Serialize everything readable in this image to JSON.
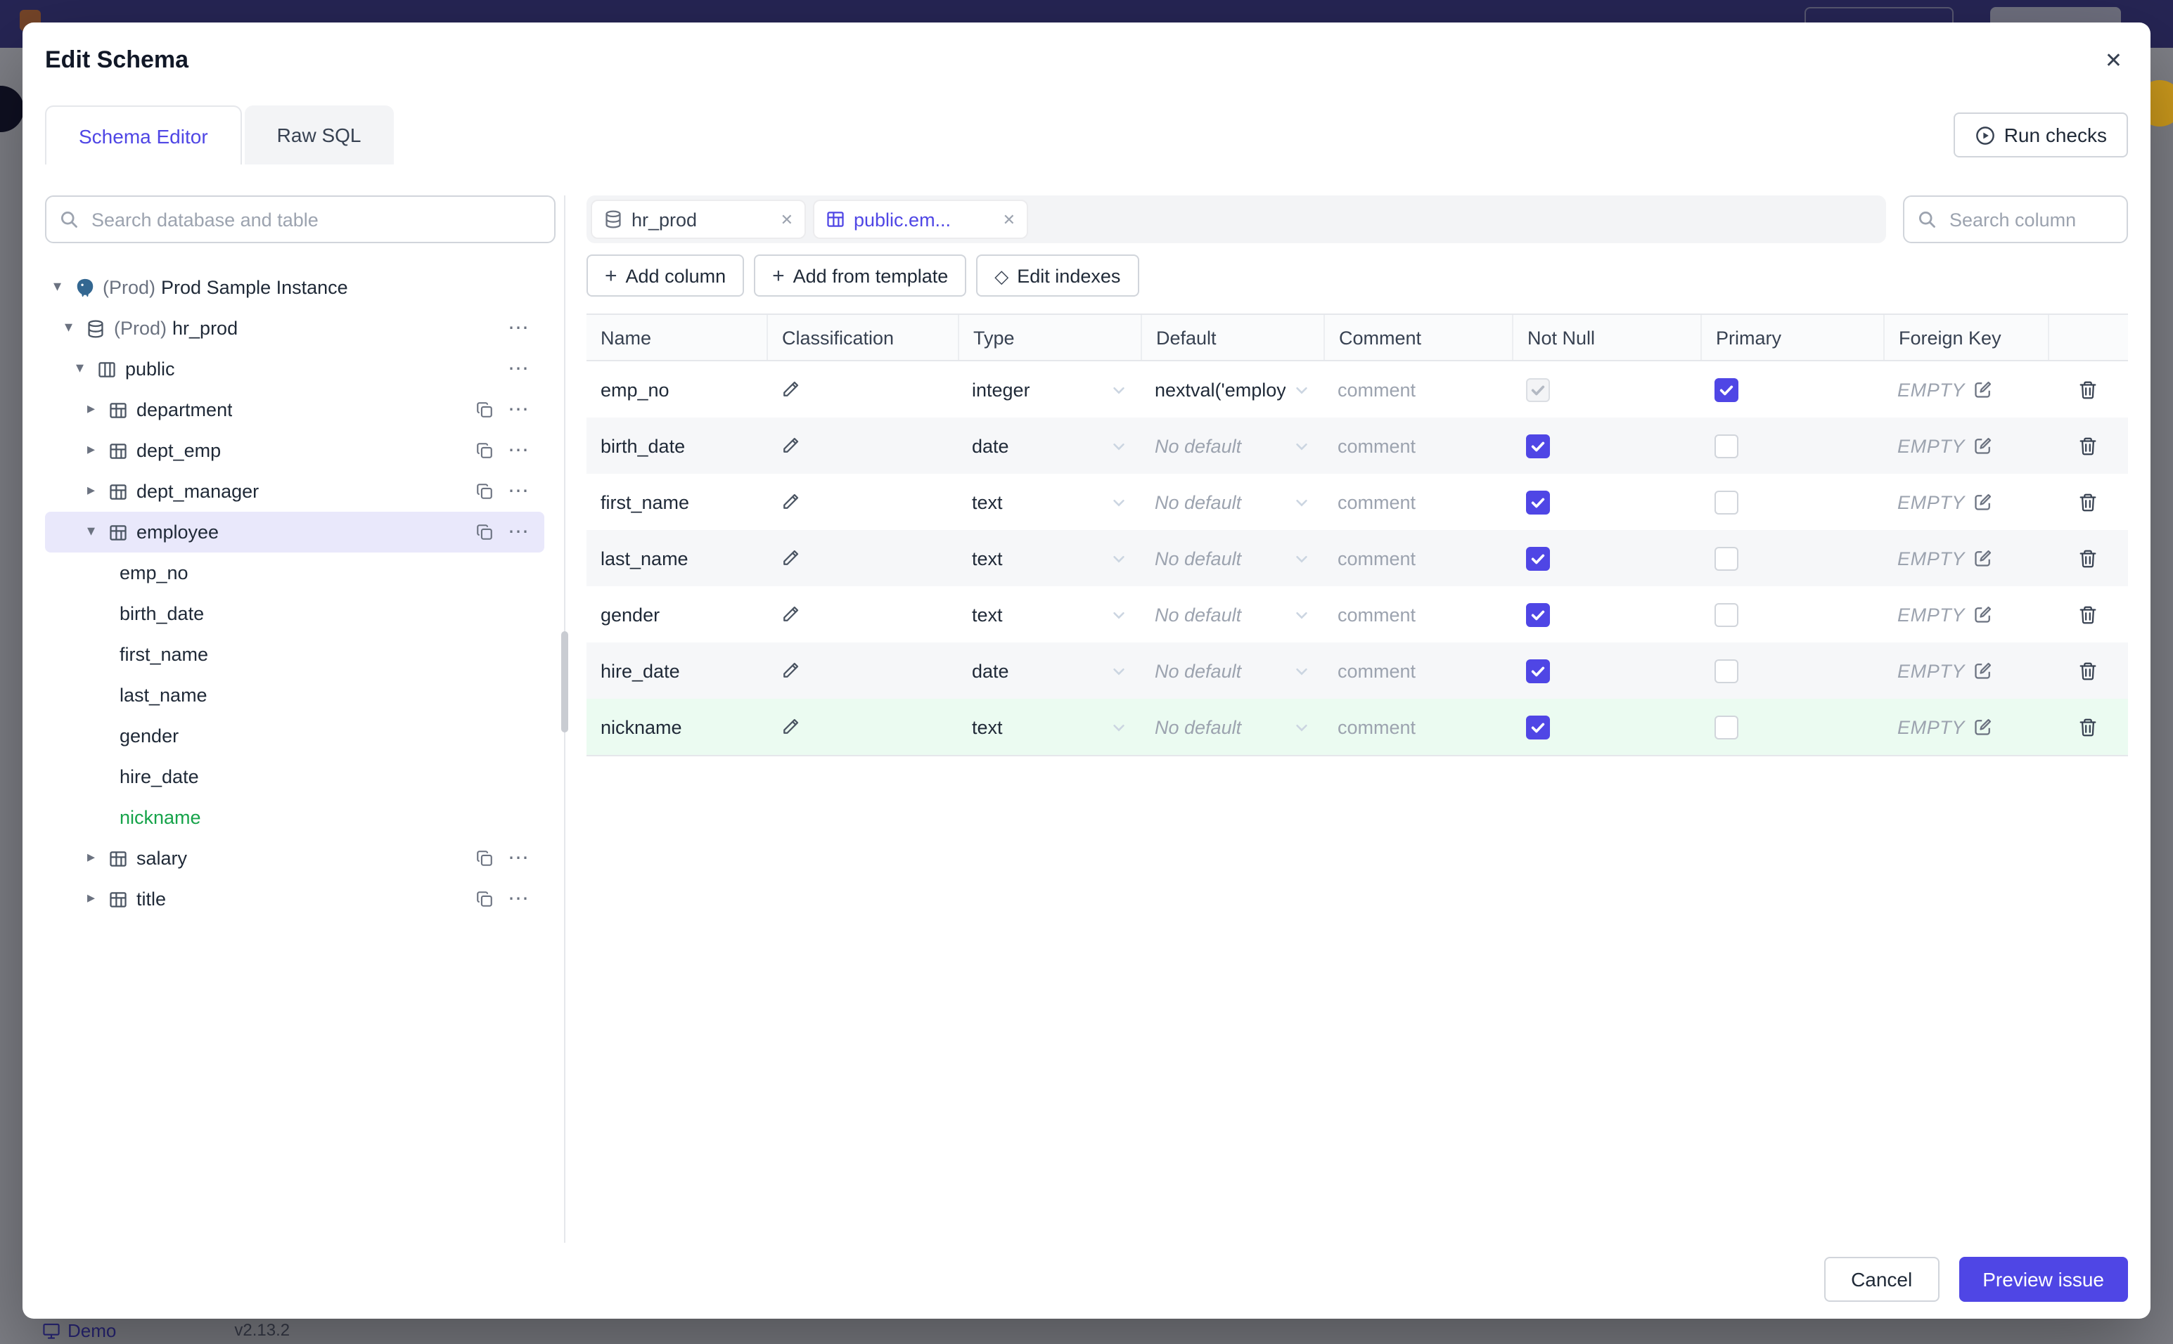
{
  "background": {
    "footer": {
      "demo": "Demo",
      "version": "v2.13.2"
    }
  },
  "colors": {
    "accent": "#4f46e5",
    "new_item_green": "#16a34a",
    "selected_tree_bg": "#e9e8fb",
    "new_row_bg": "#ebfbf1",
    "topbar": "#454295"
  },
  "icons_used": [
    "search-icon",
    "database-icon",
    "table-icon",
    "schema-icon",
    "instance-icon",
    "copy-icon",
    "more-icon",
    "pencil-icon",
    "edit-icon",
    "trash-icon",
    "play-circle-icon",
    "chevron-down-icon",
    "chevron-right-icon",
    "close-icon",
    "monitor-icon",
    "plus-icon",
    "diamond-icon",
    "checkbox"
  ],
  "modal": {
    "title": "Edit Schema",
    "tabs": [
      {
        "label": "Schema Editor",
        "active": true
      },
      {
        "label": "Raw SQL",
        "active": false
      }
    ],
    "run_checks": "Run checks",
    "sidebar": {
      "search_placeholder": "Search database and table",
      "tree": [
        {
          "level": 0,
          "kind": "instance",
          "expander": "open",
          "icon": "instance",
          "prefix": "(Prod)",
          "label": "Prod Sample Instance"
        },
        {
          "level": 1,
          "kind": "database",
          "expander": "open",
          "icon": "database",
          "prefix": "(Prod)",
          "label": "hr_prod",
          "actions": [
            "more"
          ]
        },
        {
          "level": 2,
          "kind": "schema",
          "expander": "open",
          "icon": "schema",
          "label": "public",
          "actions": [
            "more"
          ]
        },
        {
          "level": 3,
          "kind": "table",
          "expander": "closed",
          "icon": "table",
          "label": "department",
          "actions": [
            "copy",
            "more"
          ]
        },
        {
          "level": 3,
          "kind": "table",
          "expander": "closed",
          "icon": "table",
          "label": "dept_emp",
          "actions": [
            "copy",
            "more"
          ]
        },
        {
          "level": 3,
          "kind": "table",
          "expander": "closed",
          "icon": "table",
          "label": "dept_manager",
          "actions": [
            "copy",
            "more"
          ]
        },
        {
          "level": 3,
          "kind": "table",
          "expander": "open",
          "icon": "table",
          "label": "employee",
          "selected": true,
          "actions": [
            "copy",
            "more"
          ]
        },
        {
          "level": 4,
          "kind": "column",
          "label": "emp_no"
        },
        {
          "level": 4,
          "kind": "column",
          "label": "birth_date"
        },
        {
          "level": 4,
          "kind": "column",
          "label": "first_name"
        },
        {
          "level": 4,
          "kind": "column",
          "label": "last_name"
        },
        {
          "level": 4,
          "kind": "column",
          "label": "gender"
        },
        {
          "level": 4,
          "kind": "column",
          "label": "hire_date"
        },
        {
          "level": 4,
          "kind": "column",
          "label": "nickname",
          "green": true
        },
        {
          "level": 3,
          "kind": "table",
          "expander": "closed",
          "icon": "table",
          "label": "salary",
          "actions": [
            "copy",
            "more"
          ]
        },
        {
          "level": 3,
          "kind": "table",
          "expander": "closed",
          "icon": "table",
          "label": "title",
          "actions": [
            "copy",
            "more"
          ]
        }
      ]
    },
    "main": {
      "chips": [
        {
          "label": "hr_prod",
          "icon": "database",
          "active": false
        },
        {
          "label": "public.em...",
          "icon": "table",
          "active": true
        }
      ],
      "column_search_placeholder": "Search column",
      "actions": {
        "add_column": "Add column",
        "add_from_template": "Add from template",
        "edit_indexes": "Edit indexes"
      },
      "table": {
        "headers": [
          "Name",
          "Classification",
          "Type",
          "Default",
          "Comment",
          "Not Null",
          "Primary",
          "Foreign Key",
          ""
        ],
        "comment_placeholder": "comment",
        "fk_empty": "EMPTY",
        "rows": [
          {
            "name": "emp_no",
            "type": "integer",
            "default": "nextval('employ",
            "default_placeholder": false,
            "not_null": "checked-disabled",
            "primary": "checked"
          },
          {
            "name": "birth_date",
            "type": "date",
            "default": "No default",
            "default_placeholder": true,
            "not_null": "checked",
            "primary": "unchecked"
          },
          {
            "name": "first_name",
            "type": "text",
            "default": "No default",
            "default_placeholder": true,
            "not_null": "checked",
            "primary": "unchecked"
          },
          {
            "name": "last_name",
            "type": "text",
            "default": "No default",
            "default_placeholder": true,
            "not_null": "checked",
            "primary": "unchecked"
          },
          {
            "name": "gender",
            "type": "text",
            "default": "No default",
            "default_placeholder": true,
            "not_null": "checked",
            "primary": "unchecked"
          },
          {
            "name": "hire_date",
            "type": "date",
            "default": "No default",
            "default_placeholder": true,
            "not_null": "checked",
            "primary": "unchecked"
          },
          {
            "name": "nickname",
            "type": "text",
            "default": "No default",
            "default_placeholder": true,
            "not_null": "checked",
            "primary": "unchecked",
            "highlight": "green"
          }
        ]
      }
    },
    "footer": {
      "cancel": "Cancel",
      "primary": "Preview issue"
    }
  }
}
